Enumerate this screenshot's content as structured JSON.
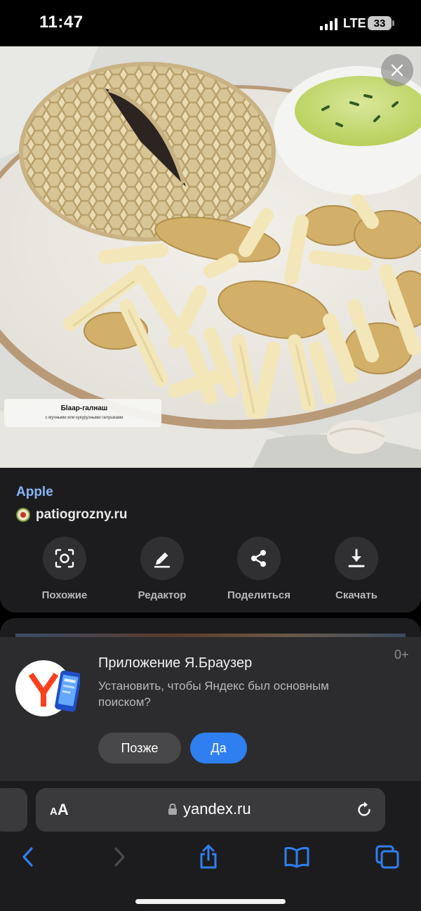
{
  "status_bar": {
    "time": "11:47",
    "network": "LTE",
    "battery_level": "33"
  },
  "image_viewer": {
    "photo_caption_title": "Бlаар-галнаш",
    "photo_caption_subtitle": "с мучными или кукурузными галушками",
    "close_icon": "close-icon"
  },
  "source": {
    "title": "Apple",
    "site": "patiogrozny.ru"
  },
  "actions": [
    {
      "label": "Похожие",
      "icon": "scan-icon"
    },
    {
      "label": "Редактор",
      "icon": "pencil-icon"
    },
    {
      "label": "Поделиться",
      "icon": "share-icon"
    },
    {
      "label": "Скачать",
      "icon": "download-icon"
    }
  ],
  "banner": {
    "title": "Приложение Я.Браузер",
    "description": "Установить, чтобы Яндекс был основным поиском?",
    "age_rating": "0+",
    "later_label": "Позже",
    "yes_label": "Да"
  },
  "browser": {
    "aa_small": "A",
    "aa_large": "A",
    "url": "yandex.ru"
  },
  "colors": {
    "accent_blue": "#2f7ff0",
    "source_title": "#8ab4f8",
    "card_bg": "#1c1c1e",
    "banner_bg": "#2c2c2e"
  }
}
